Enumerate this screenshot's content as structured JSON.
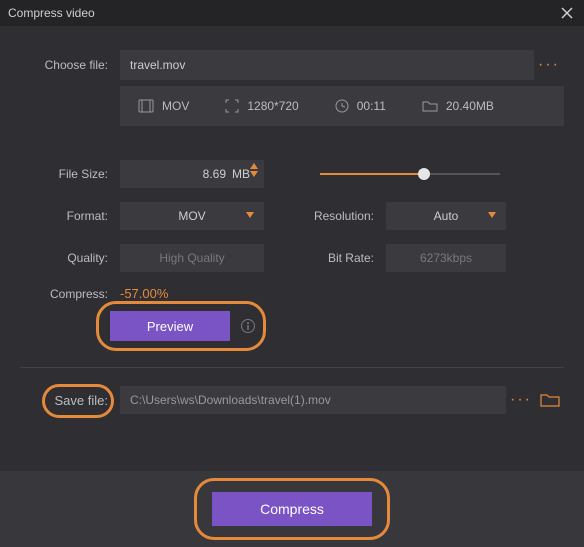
{
  "window": {
    "title": "Compress video"
  },
  "file": {
    "label": "Choose file:",
    "name": "travel.mov",
    "format": "MOV",
    "resolution": "1280*720",
    "duration": "00:11",
    "size": "20.40MB"
  },
  "settings": {
    "filesize_label": "File Size:",
    "filesize_value": "8.69",
    "filesize_unit": "MB",
    "format_label": "Format:",
    "format_value": "MOV",
    "quality_label": "Quality:",
    "quality_value": "High Quality",
    "resolution_label": "Resolution:",
    "resolution_value": "Auto",
    "bitrate_label": "Bit Rate:",
    "bitrate_value": "6273kbps",
    "slider_percent": 58
  },
  "compress": {
    "label": "Compress:",
    "value": "-57.00%",
    "preview_label": "Preview"
  },
  "save": {
    "label": "Save file:",
    "path": "C:\\Users\\ws\\Downloads\\travel(1).mov"
  },
  "action": {
    "button": "Compress"
  },
  "colors": {
    "accent": "#e58a3a",
    "primary": "#7a53c4"
  }
}
